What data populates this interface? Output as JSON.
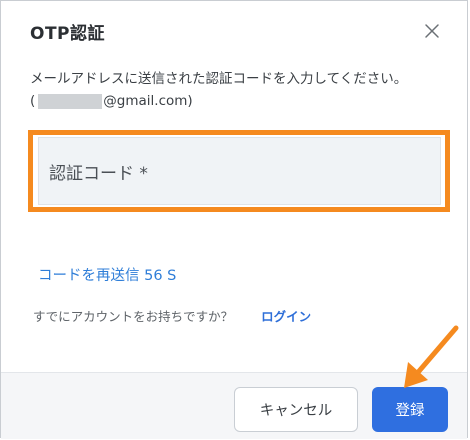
{
  "dialog": {
    "title": "OTP認証",
    "close_icon": "close-icon",
    "message": "メールアドレスに送信された認証コードを入力してください。",
    "email": {
      "open_paren": "(",
      "suffix": "@gmail.com)"
    }
  },
  "otp_input": {
    "placeholder": "認証コード *",
    "value": ""
  },
  "resend": {
    "label": "コードを再送信",
    "countdown": "56 S"
  },
  "account": {
    "question": "すでにアカウントをお持ちですか？",
    "login_label": "ログイン"
  },
  "footer": {
    "cancel_label": "キャンセル",
    "submit_label": "登録"
  },
  "colors": {
    "highlight": "#f58a1f",
    "primary": "#2f6fe0",
    "link": "#2f7ed8"
  }
}
